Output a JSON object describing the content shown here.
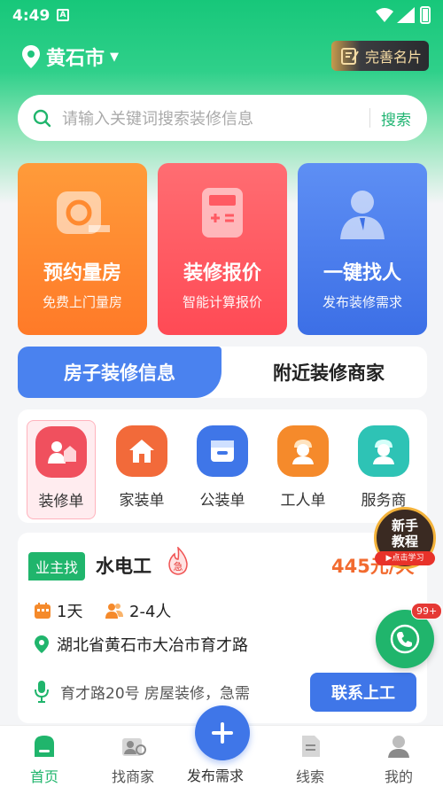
{
  "status": {
    "time": "4:49",
    "a_badge": "A"
  },
  "location": {
    "city": "黄石市"
  },
  "card_button": {
    "label": "完善名片"
  },
  "search": {
    "placeholder": "请输入关键词搜索装修信息",
    "button": "搜索"
  },
  "tiles": [
    {
      "title": "预约量房",
      "subtitle": "免费上门量房",
      "icon": "tape-measure-icon"
    },
    {
      "title": "装修报价",
      "subtitle": "智能计算报价",
      "icon": "calculator-icon"
    },
    {
      "title": "一键找人",
      "subtitle": "发布装修需求",
      "icon": "person-icon"
    }
  ],
  "segment": {
    "active": "房子装修信息",
    "inactive": "附近装修商家"
  },
  "categories": [
    {
      "label": "装修单",
      "icon": "house-person-icon",
      "color": "#f0505e",
      "selected": true
    },
    {
      "label": "家装单",
      "icon": "home-icon",
      "color": "#f26a3a"
    },
    {
      "label": "公装单",
      "icon": "store-icon",
      "color": "#3f76e8"
    },
    {
      "label": "工人单",
      "icon": "worker-icon",
      "color": "#f58a2b"
    },
    {
      "label": "服务商",
      "icon": "engineer-icon",
      "color": "#2ec3b5"
    }
  ],
  "task": {
    "tag": "业主找",
    "name": "水电工",
    "urgent": "急",
    "price": "445元/天",
    "days": "1天",
    "people": "2-4人",
    "address": "湖北省黄石市大冶市育才路",
    "description": "育才路20号 房屋装修，急需",
    "contact_button": "联系上工"
  },
  "tutorial": {
    "line1": "新手",
    "line2": "教程",
    "pill": "▶点击学习"
  },
  "phone_badge": "99+",
  "tabbar": {
    "items": [
      {
        "label": "首页",
        "icon": "home-tab-icon",
        "active": true
      },
      {
        "label": "找商家",
        "icon": "merchant-icon"
      },
      {
        "label": "发布需求",
        "icon": "plus-icon"
      },
      {
        "label": "线索",
        "icon": "document-icon"
      },
      {
        "label": "我的",
        "icon": "profile-icon"
      }
    ]
  },
  "colors": {
    "brand_green": "#20b56c",
    "brand_blue": "#3f76e8",
    "price_orange": "#f26b30"
  }
}
